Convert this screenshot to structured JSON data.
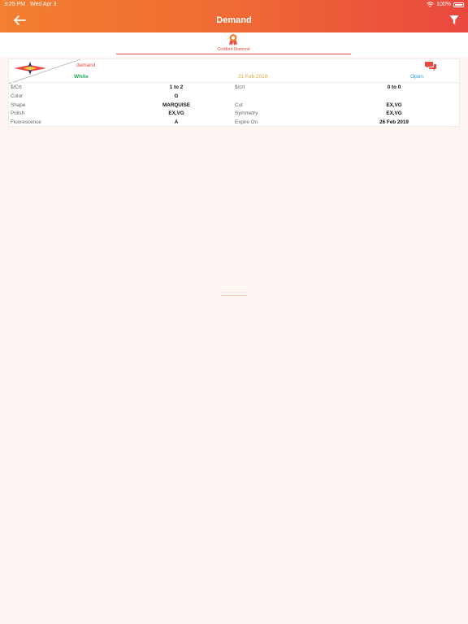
{
  "status_bar": {
    "time": "3:25 PM",
    "date": "Wed Apr 3",
    "battery": "100%"
  },
  "header": {
    "title": "Demand",
    "back_icon": "arrow-left-icon",
    "filter_icon": "filter-funnel-icon"
  },
  "tabs": [
    {
      "label": "Certified Diamond",
      "icon": "award-ribbon-icon"
    }
  ],
  "card": {
    "title": "demand",
    "color_type": "White",
    "posted_date": "21 Feb 2019",
    "status": "Open",
    "rows": [
      {
        "left_label": "$/Crt",
        "left_value": "1 to 2",
        "right_label": "$/crt",
        "right_value": "0 to 0"
      },
      {
        "left_label": "Color",
        "left_value": "G",
        "right_label": "",
        "right_value": ""
      },
      {
        "left_label": "Shape",
        "left_value": "MARQUISE",
        "right_label": "Cut",
        "right_value": "EX,VG"
      },
      {
        "left_label": "Polish",
        "left_value": "EX,VG",
        "right_label": "Symmetry",
        "right_value": "EX,VG"
      },
      {
        "left_label": "Fluorescence",
        "left_value": "A",
        "right_label": "Expire On",
        "right_value": "26 Feb 2019"
      }
    ]
  },
  "colors": {
    "header_start": "#f47f2f",
    "header_end": "#e9483f",
    "accent_red": "#e9483f",
    "green": "#2aa35c",
    "orange": "#e8a530",
    "blue": "#2b9bd9"
  }
}
